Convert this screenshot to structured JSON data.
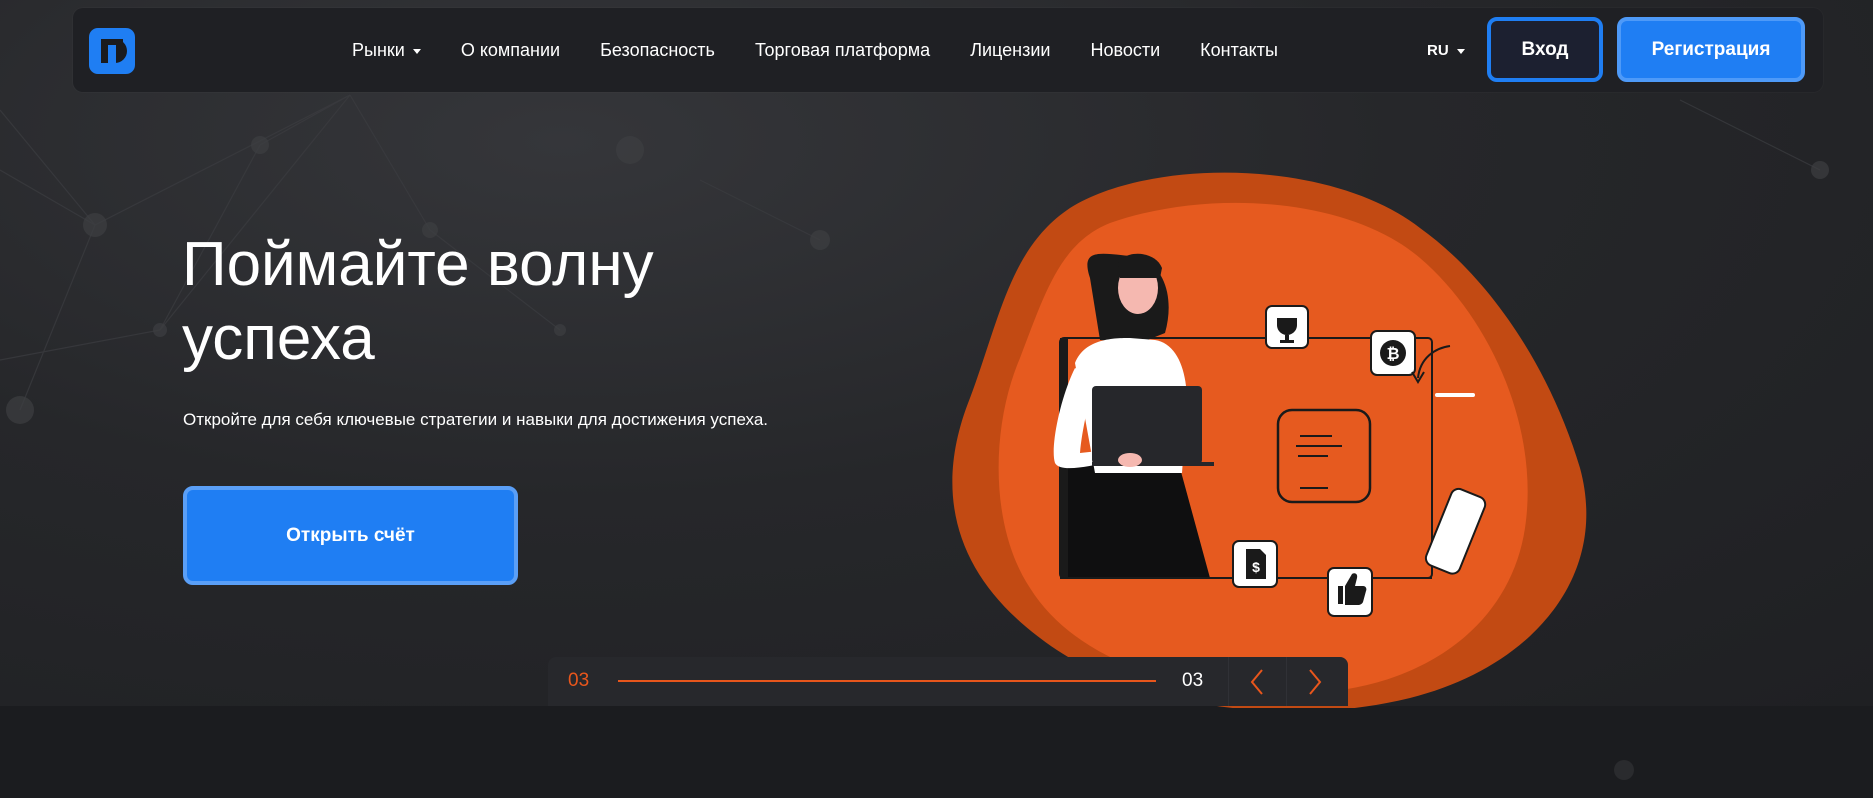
{
  "header": {
    "logo_icon": "brand-logo-icon",
    "nav": [
      {
        "label": "Рынки",
        "has_dropdown": true
      },
      {
        "label": "О компании"
      },
      {
        "label": "Безопасность"
      },
      {
        "label": "Торговая платформа"
      },
      {
        "label": "Лицензии"
      },
      {
        "label": "Новости"
      },
      {
        "label": "Контакты"
      }
    ],
    "language": "RU",
    "login_label": "Вход",
    "register_label": "Регистрация"
  },
  "hero": {
    "title_line1": "Поймайте волну",
    "title_line2": "успеха",
    "subtitle": "Откройте для себя ключевые стратегии и навыки для достижения успеха.",
    "cta_label": "Открыть счёт"
  },
  "slider": {
    "current": "03",
    "total": "03",
    "progress": 1.0
  },
  "colors": {
    "accent_blue": "#1f7ef3",
    "accent_orange": "#e8561c",
    "background": "#1d1e21"
  },
  "icons": [
    "trophy-icon",
    "bitcoin-icon",
    "dollar-document-icon",
    "thumbs-up-icon",
    "chevron-left-icon",
    "chevron-right-icon"
  ]
}
